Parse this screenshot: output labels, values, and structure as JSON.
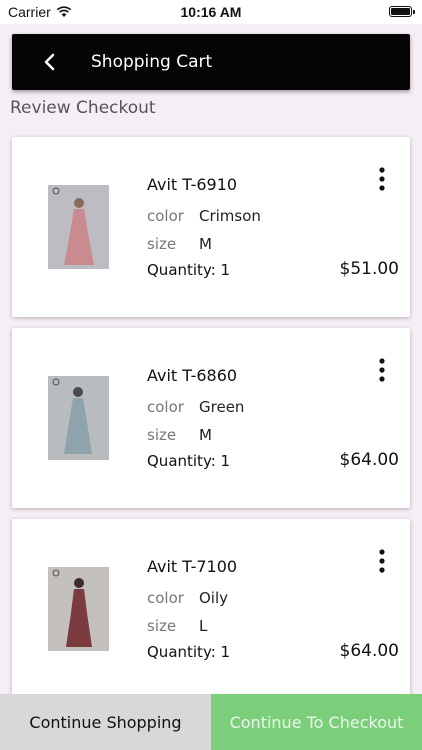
{
  "status_bar": {
    "carrier": "Carrier",
    "time": "10:16 AM",
    "battery": 1.0
  },
  "header": {
    "title": "Shopping Cart",
    "back_icon": "chevron-left-icon"
  },
  "section_title": "Review Checkout",
  "attr_labels": {
    "color": "color",
    "size": "size"
  },
  "items": [
    {
      "name": "Avit T-6910",
      "color": "Crimson",
      "size": "M",
      "quantity": "Quantity: 1",
      "price": "$51.00",
      "dress_color": "#c98a90",
      "bg_color": "#bcbcc2"
    },
    {
      "name": "Avit T-6860",
      "color": "Green",
      "size": "M",
      "quantity": "Quantity: 1",
      "price": "$64.00",
      "dress_color": "#8fa3ad",
      "bg_color": "#b8bcbf"
    },
    {
      "name": "Avit T-7100",
      "color": "Oily",
      "size": "L",
      "quantity": "Quantity: 1",
      "price": "$64.00",
      "dress_color": "#7a3a3e",
      "bg_color": "#c2bfbd"
    }
  ],
  "footer": {
    "continue_shopping": "Continue Shopping",
    "continue_checkout": "Continue To Checkout"
  },
  "colors": {
    "header_bg": "#050505",
    "checkout_green": "#7ccf7a",
    "continue_gray": "#d8d8d8"
  }
}
